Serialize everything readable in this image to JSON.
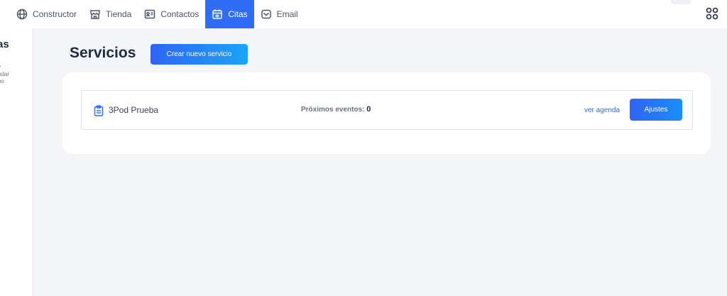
{
  "nav": {
    "items": [
      {
        "label": "Constructor",
        "icon": "globe-icon",
        "active": false
      },
      {
        "label": "Tienda",
        "icon": "store-icon",
        "active": false
      },
      {
        "label": "Contactos",
        "icon": "contact-card-icon",
        "active": false
      },
      {
        "label": "Citas",
        "icon": "calendar-icon",
        "active": true
      },
      {
        "label": "Email",
        "icon": "mail-icon",
        "active": false
      }
    ],
    "apps_icon": "apps-grid-icon"
  },
  "sidebar": {
    "title": "as",
    "description_lines": [
      "y",
      "ndar",
      "po"
    ]
  },
  "main": {
    "heading": "Servicios",
    "create_button": "Crear nuevo servicio",
    "services": [
      {
        "name": "3Pod Prueba",
        "icon": "clipboard-icon",
        "events_label": "Próximos eventos:",
        "events_count": "0",
        "link_label": "ver agenda",
        "button_label": "Ajustes"
      }
    ]
  },
  "colors": {
    "accent": "#2f6df6",
    "background": "#f4f5f9",
    "panel": "#ffffff",
    "text_dark": "#1f2a44"
  }
}
